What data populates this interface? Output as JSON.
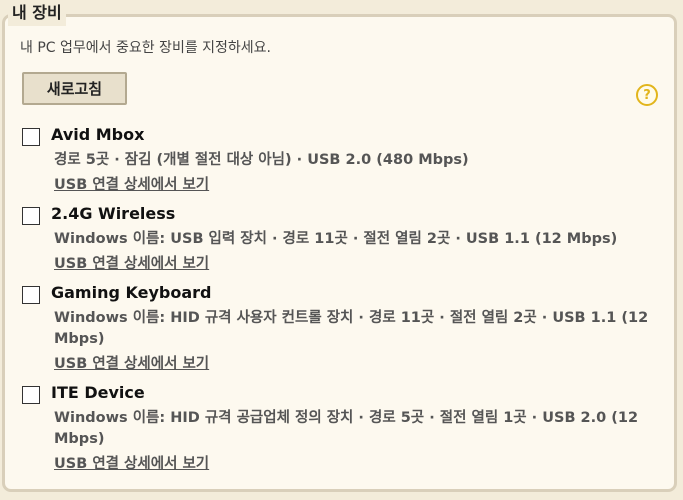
{
  "section": {
    "legend": "내 장비",
    "intro": "내 PC 업무에서 중요한 장비를 지정하세요.",
    "refresh_label": "새로고침",
    "help_glyph": "?"
  },
  "devices": [
    {
      "name": "Avid Mbox",
      "description": "경로 5곳 · 잠김 (개별 절전 대상 아님) · USB 2.0 (480 Mbps)",
      "link": "USB 연결 상세에서 보기",
      "checked": false
    },
    {
      "name": "2.4G Wireless",
      "description": "Windows 이름: USB 입력 장치 · 경로 11곳 · 절전 열림 2곳 · USB 1.1 (12 Mbps)",
      "link": "USB 연결 상세에서 보기",
      "checked": false
    },
    {
      "name": "Gaming Keyboard",
      "description": "Windows 이름: HID 규격 사용자 컨트롤 장치 · 경로 11곳 · 절전 열림 2곳 · USB 1.1 (12 Mbps)",
      "link": "USB 연결 상세에서 보기",
      "checked": false
    },
    {
      "name": "ITE Device",
      "description": "Windows 이름: HID 규격 공급업체 정의 장치 · 경로 5곳 · 절전 열림 1곳 · USB 2.0 (12 Mbps)",
      "link": "USB 연결 상세에서 보기",
      "checked": false
    }
  ],
  "colors": {
    "background": "#f3ecda",
    "panel": "#fdf9ef",
    "border": "#d9cfba",
    "help_accent": "#e2b51c"
  }
}
